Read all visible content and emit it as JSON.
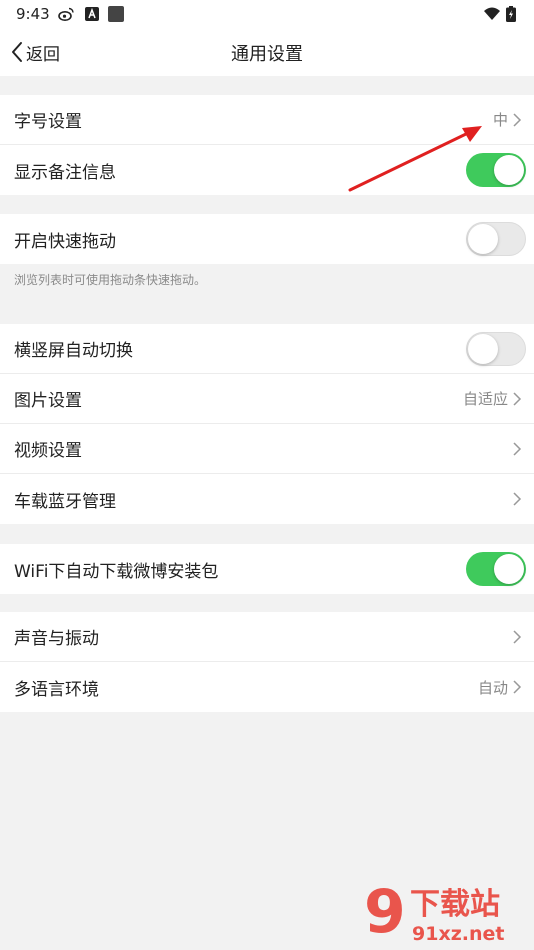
{
  "status_bar": {
    "time": "9:43"
  },
  "nav": {
    "back_label": "返回",
    "title": "通用设置"
  },
  "groups": [
    {
      "items": [
        {
          "label": "字号设置",
          "value": "中",
          "type": "link"
        },
        {
          "label": "显示备注信息",
          "type": "toggle",
          "state": "on"
        }
      ]
    },
    {
      "items": [
        {
          "label": "开启快速拖动",
          "type": "toggle",
          "state": "off"
        }
      ],
      "hint": "浏览列表时可使用拖动条快速拖动。"
    },
    {
      "items": [
        {
          "label": "横竖屏自动切换",
          "type": "toggle",
          "state": "off"
        },
        {
          "label": "图片设置",
          "value": "自适应",
          "type": "link"
        },
        {
          "label": "视频设置",
          "type": "link"
        },
        {
          "label": "车载蓝牙管理",
          "type": "link"
        }
      ]
    },
    {
      "items": [
        {
          "label": "WiFi下自动下载微博安装包",
          "type": "toggle",
          "state": "on"
        }
      ]
    },
    {
      "items": [
        {
          "label": "声音与振动",
          "type": "link"
        },
        {
          "label": "多语言环境",
          "value": "自动",
          "type": "link"
        }
      ]
    }
  ],
  "watermark": {
    "number": "9",
    "text": "下载站",
    "domain": "91xz.net"
  },
  "colors": {
    "toggle_on": "#3fca5c",
    "annotation_arrow": "#e02020",
    "watermark_red": "#e8392f"
  },
  "icons": [
    "weibo-icon",
    "a-box-icon",
    "square-notification-icon",
    "wifi-icon",
    "battery-charging-icon",
    "back-chevron-icon",
    "chevron-right-icon"
  ]
}
